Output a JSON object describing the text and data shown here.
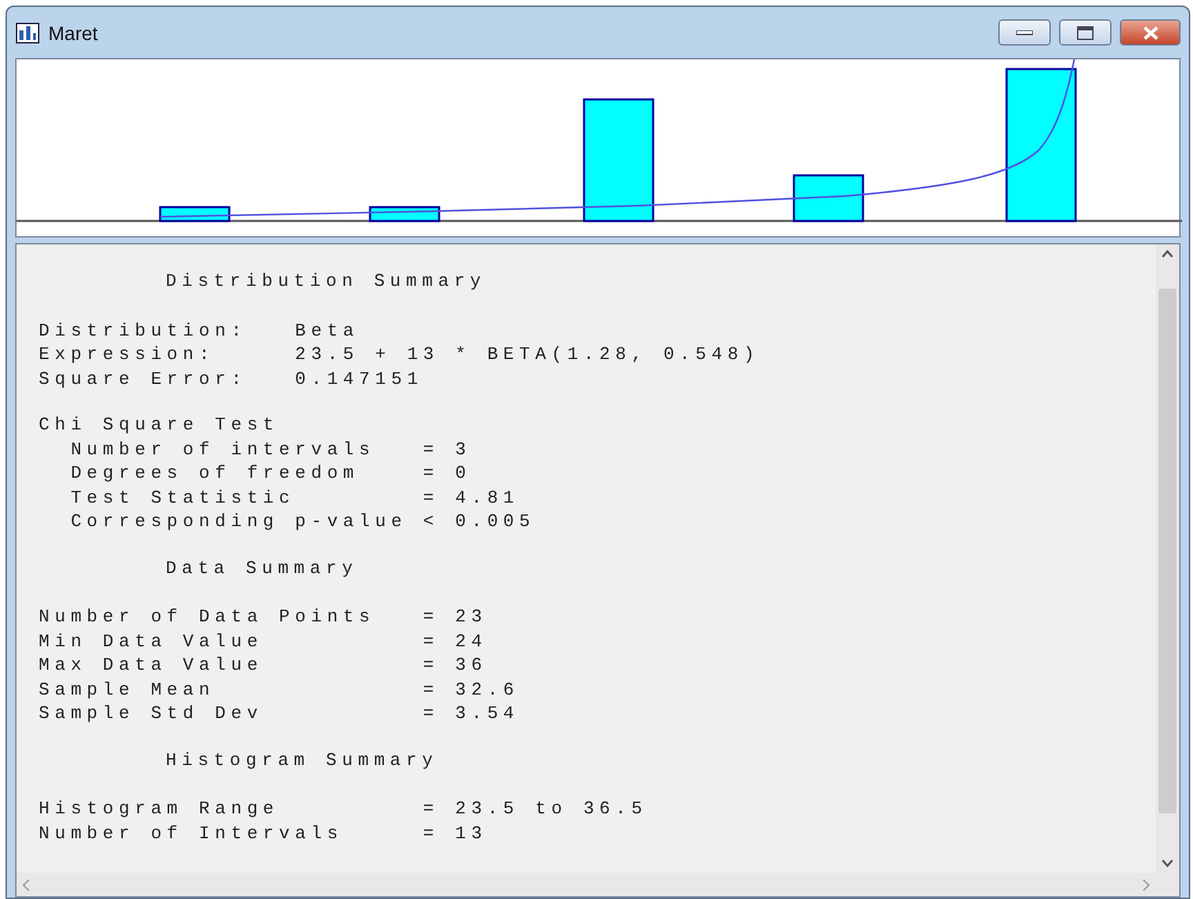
{
  "window": {
    "title": "Maret"
  },
  "report": [
    {
      "heading": "Distribution Summary",
      "lines": [
        "Distribution:   Beta",
        "Expression:     23.5 + 13 * BETA(1.28, 0.548)",
        "Square Error:   0.147151"
      ]
    },
    {
      "lines": [
        "Chi Square Test",
        "  Number of intervals   = 3",
        "  Degrees of freedom    = 0",
        "  Test Statistic        = 4.81",
        "  Corresponding p-value < 0.005"
      ]
    },
    {
      "heading": "Data Summary",
      "lines": [
        "Number of Data Points   = 23",
        "Min Data Value          = 24",
        "Max Data Value          = 36",
        "Sample Mean             = 32.6",
        "Sample Std Dev          = 3.54"
      ]
    },
    {
      "heading": "Histogram Summary",
      "lines": [
        "Histogram Range         = 23.5 to 36.5",
        "Number of Intervals     = 13"
      ]
    }
  ]
}
